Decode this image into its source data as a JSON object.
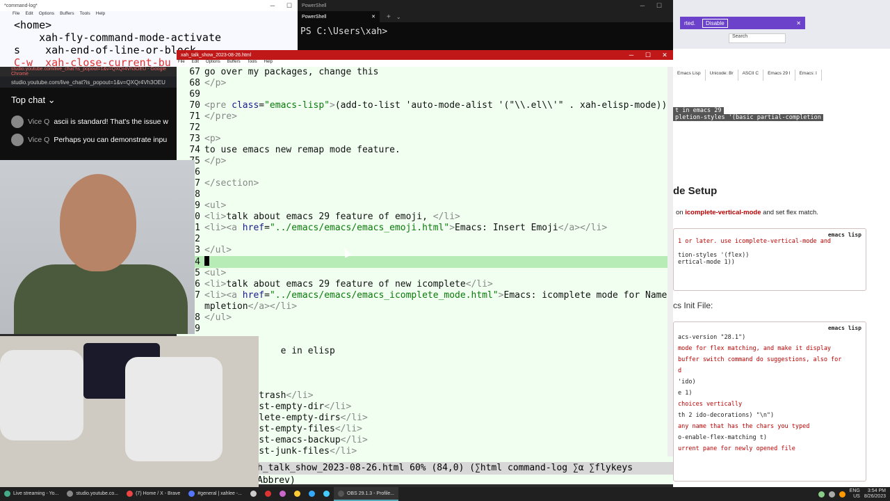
{
  "cmdlog": {
    "title": "*command-log*",
    "menu": [
      "File",
      "Edit",
      "Options",
      "Buffers",
      "Tools",
      "Help"
    ],
    "lines": [
      "<home>",
      "    xah-fly-command-mode-activate",
      "s    xah-end-of-line-or-block",
      "C-w  xah-close-current-bu"
    ]
  },
  "pwsh": {
    "title": "PowerShell",
    "tab": "PowerShell",
    "prompt": "PS C:\\Users\\xah>"
  },
  "chat": {
    "window_title": "studio.youtube.com/live_chat?is_popout=1&v=QXQr4Vh3OEU - Google Chrome",
    "url": "studio.youtube.com/live_chat?is_popout=1&v=QXQr4Vh3OEU",
    "header": "Top chat",
    "messages": [
      {
        "author": "Vice Q",
        "text": "ascii is standard! That's the issue w"
      },
      {
        "author": "Vice Q",
        "text": "Perhaps you can demonstrate inpu"
      }
    ]
  },
  "browser": {
    "banner_text": "rted.",
    "disable_label": "Disable",
    "search_placeholder": "Search",
    "tabs": [
      "Emacs Lisp",
      "Unicode: Br",
      "ASCII C",
      "Emacs 29 I",
      "Emacs: I"
    ],
    "line1": "t in emacs 29",
    "line2": "pletion-styles '(basic partial-completion",
    "heading1": "de Setup",
    "para_prefix": "on ",
    "para_code": "icomplete-vertical-mode",
    "para_suffix": " and set flex match.",
    "box1_lang": "emacs lisp",
    "box1_lines": [
      "1 or later. use icomplete-vertical-mode and",
      "",
      "tion-styles '(flex))",
      "ertical-mode 1))"
    ],
    "heading2": "cs Init File:",
    "box2_lang": "emacs lisp",
    "box2_lines": [
      "acs-version \"28.1\")",
      "",
      "mode for flex matching, and make it display",
      "",
      "",
      "buffer switch command do suggestions, also for",
      "d",
      "'ido)",
      "e 1)",
      "choices vertically",
      "th 2 ido-decorations) \"\\n\")",
      "any name that has the chars you typed",
      "o-enable-flex-matching t)",
      "urrent pane for newly opened file"
    ]
  },
  "emacs": {
    "title": "xah_talk_show_2023-08-26.html",
    "menu": [
      "File",
      "Edit",
      "Options",
      "Buffers",
      "Tools",
      "Help"
    ],
    "modeline": "h_talk_show_2023-08-26.html 60% (84,0) (∑html command-log ∑α ∑flykeys Abbrev)"
  },
  "taskbar": {
    "items": [
      "Live streaming - Yo...",
      "studio.youtube.co...",
      "(7) Home / X - Brave",
      "#general | xahlee -...",
      "OBS 29.1.3 - Profile..."
    ],
    "lang": "ENG",
    "region": "US",
    "time": "3:54 PM",
    "date": "8/26/2023"
  },
  "colors": {
    "emacs_title": "#c01818",
    "emacs_bg": "#f0fff0",
    "highlight_line": "#b7ecb7",
    "banner": "#6b42c9"
  }
}
